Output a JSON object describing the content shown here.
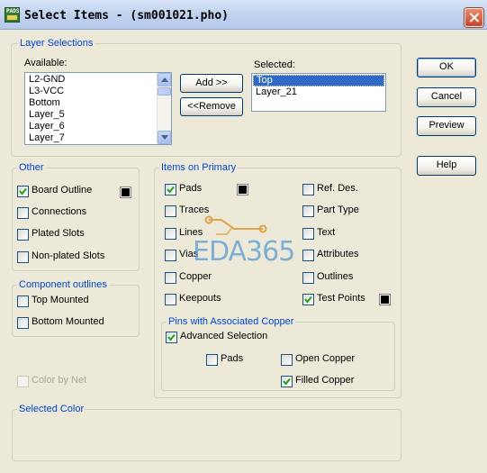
{
  "window": {
    "title": "Select Items - (sm001021.pho)",
    "app_icon_text": "PADS"
  },
  "layer_selections": {
    "group_label": "Layer Selections",
    "available_label": "Available:",
    "available_items": [
      "L2-GND",
      "L3-VCC",
      "Bottom",
      "Layer_5",
      "Layer_6",
      "Layer_7"
    ],
    "selected_label": "Selected:",
    "selected_items": [
      "Top",
      "Layer_21"
    ],
    "add_button": "Add >>",
    "remove_button": "<<Remove"
  },
  "dialog_buttons": {
    "ok": "OK",
    "cancel": "Cancel",
    "preview": "Preview",
    "help": "Help"
  },
  "other": {
    "group_label": "Other",
    "board_outline": {
      "label": "Board Outline",
      "checked": true
    },
    "connections": {
      "label": "Connections",
      "checked": false
    },
    "plated_slots": {
      "label": "Plated Slots",
      "checked": false
    },
    "non_plated_slots": {
      "label": "Non-plated Slots",
      "checked": false
    }
  },
  "component_outlines": {
    "group_label": "Component outlines",
    "top_mounted": {
      "label": "Top Mounted",
      "checked": false
    },
    "bottom_mounted": {
      "label": "Bottom Mounted",
      "checked": false
    }
  },
  "color_by_net": {
    "label": "Color by Net",
    "checked": false,
    "enabled": false
  },
  "items_on_primary": {
    "group_label": "Items on Primary",
    "pads": {
      "label": "Pads",
      "checked": true
    },
    "traces": {
      "label": "Traces",
      "checked": false
    },
    "lines": {
      "label": "Lines",
      "checked": false
    },
    "vias": {
      "label": "Vias",
      "checked": false
    },
    "copper": {
      "label": "Copper",
      "checked": false
    },
    "keepouts": {
      "label": "Keepouts",
      "checked": false
    },
    "ref_des": {
      "label": "Ref. Des.",
      "checked": false
    },
    "part_type": {
      "label": "Part Type",
      "checked": false
    },
    "text": {
      "label": "Text",
      "checked": false
    },
    "attributes": {
      "label": "Attributes",
      "checked": false
    },
    "outlines": {
      "label": "Outlines",
      "checked": false
    },
    "test_points": {
      "label": "Test Points",
      "checked": true
    }
  },
  "pins_with_copper": {
    "group_label": "Pins with Associated Copper",
    "advanced_selection": {
      "label": "Advanced Selection",
      "checked": true
    },
    "pads": {
      "label": "Pads",
      "checked": false
    },
    "open_copper": {
      "label": "Open Copper",
      "checked": false
    },
    "filled_copper": {
      "label": "Filled Copper",
      "checked": true
    }
  },
  "selected_color": {
    "group_label": "Selected Color"
  },
  "watermark": {
    "text": "EDA365"
  },
  "colors": {
    "swatch": "#000000",
    "group_label": "#0046d5",
    "selection": "#316ac5",
    "watermark": "#5b9bd5"
  }
}
